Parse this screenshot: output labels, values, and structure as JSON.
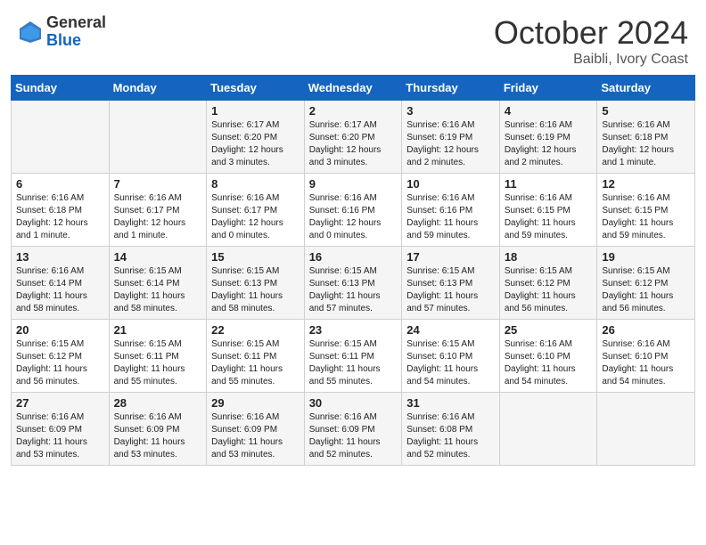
{
  "header": {
    "logo_general": "General",
    "logo_blue": "Blue",
    "month": "October 2024",
    "location": "Baibli, Ivory Coast"
  },
  "days_of_week": [
    "Sunday",
    "Monday",
    "Tuesday",
    "Wednesday",
    "Thursday",
    "Friday",
    "Saturday"
  ],
  "weeks": [
    [
      {
        "day": "",
        "info": ""
      },
      {
        "day": "",
        "info": ""
      },
      {
        "day": "1",
        "info": "Sunrise: 6:17 AM\nSunset: 6:20 PM\nDaylight: 12 hours and 3 minutes."
      },
      {
        "day": "2",
        "info": "Sunrise: 6:17 AM\nSunset: 6:20 PM\nDaylight: 12 hours and 3 minutes."
      },
      {
        "day": "3",
        "info": "Sunrise: 6:16 AM\nSunset: 6:19 PM\nDaylight: 12 hours and 2 minutes."
      },
      {
        "day": "4",
        "info": "Sunrise: 6:16 AM\nSunset: 6:19 PM\nDaylight: 12 hours and 2 minutes."
      },
      {
        "day": "5",
        "info": "Sunrise: 6:16 AM\nSunset: 6:18 PM\nDaylight: 12 hours and 1 minute."
      }
    ],
    [
      {
        "day": "6",
        "info": "Sunrise: 6:16 AM\nSunset: 6:18 PM\nDaylight: 12 hours and 1 minute."
      },
      {
        "day": "7",
        "info": "Sunrise: 6:16 AM\nSunset: 6:17 PM\nDaylight: 12 hours and 1 minute."
      },
      {
        "day": "8",
        "info": "Sunrise: 6:16 AM\nSunset: 6:17 PM\nDaylight: 12 hours and 0 minutes."
      },
      {
        "day": "9",
        "info": "Sunrise: 6:16 AM\nSunset: 6:16 PM\nDaylight: 12 hours and 0 minutes."
      },
      {
        "day": "10",
        "info": "Sunrise: 6:16 AM\nSunset: 6:16 PM\nDaylight: 11 hours and 59 minutes."
      },
      {
        "day": "11",
        "info": "Sunrise: 6:16 AM\nSunset: 6:15 PM\nDaylight: 11 hours and 59 minutes."
      },
      {
        "day": "12",
        "info": "Sunrise: 6:16 AM\nSunset: 6:15 PM\nDaylight: 11 hours and 59 minutes."
      }
    ],
    [
      {
        "day": "13",
        "info": "Sunrise: 6:16 AM\nSunset: 6:14 PM\nDaylight: 11 hours and 58 minutes."
      },
      {
        "day": "14",
        "info": "Sunrise: 6:15 AM\nSunset: 6:14 PM\nDaylight: 11 hours and 58 minutes."
      },
      {
        "day": "15",
        "info": "Sunrise: 6:15 AM\nSunset: 6:13 PM\nDaylight: 11 hours and 58 minutes."
      },
      {
        "day": "16",
        "info": "Sunrise: 6:15 AM\nSunset: 6:13 PM\nDaylight: 11 hours and 57 minutes."
      },
      {
        "day": "17",
        "info": "Sunrise: 6:15 AM\nSunset: 6:13 PM\nDaylight: 11 hours and 57 minutes."
      },
      {
        "day": "18",
        "info": "Sunrise: 6:15 AM\nSunset: 6:12 PM\nDaylight: 11 hours and 56 minutes."
      },
      {
        "day": "19",
        "info": "Sunrise: 6:15 AM\nSunset: 6:12 PM\nDaylight: 11 hours and 56 minutes."
      }
    ],
    [
      {
        "day": "20",
        "info": "Sunrise: 6:15 AM\nSunset: 6:12 PM\nDaylight: 11 hours and 56 minutes."
      },
      {
        "day": "21",
        "info": "Sunrise: 6:15 AM\nSunset: 6:11 PM\nDaylight: 11 hours and 55 minutes."
      },
      {
        "day": "22",
        "info": "Sunrise: 6:15 AM\nSunset: 6:11 PM\nDaylight: 11 hours and 55 minutes."
      },
      {
        "day": "23",
        "info": "Sunrise: 6:15 AM\nSunset: 6:11 PM\nDaylight: 11 hours and 55 minutes."
      },
      {
        "day": "24",
        "info": "Sunrise: 6:15 AM\nSunset: 6:10 PM\nDaylight: 11 hours and 54 minutes."
      },
      {
        "day": "25",
        "info": "Sunrise: 6:16 AM\nSunset: 6:10 PM\nDaylight: 11 hours and 54 minutes."
      },
      {
        "day": "26",
        "info": "Sunrise: 6:16 AM\nSunset: 6:10 PM\nDaylight: 11 hours and 54 minutes."
      }
    ],
    [
      {
        "day": "27",
        "info": "Sunrise: 6:16 AM\nSunset: 6:09 PM\nDaylight: 11 hours and 53 minutes."
      },
      {
        "day": "28",
        "info": "Sunrise: 6:16 AM\nSunset: 6:09 PM\nDaylight: 11 hours and 53 minutes."
      },
      {
        "day": "29",
        "info": "Sunrise: 6:16 AM\nSunset: 6:09 PM\nDaylight: 11 hours and 53 minutes."
      },
      {
        "day": "30",
        "info": "Sunrise: 6:16 AM\nSunset: 6:09 PM\nDaylight: 11 hours and 52 minutes."
      },
      {
        "day": "31",
        "info": "Sunrise: 6:16 AM\nSunset: 6:08 PM\nDaylight: 11 hours and 52 minutes."
      },
      {
        "day": "",
        "info": ""
      },
      {
        "day": "",
        "info": ""
      }
    ]
  ]
}
